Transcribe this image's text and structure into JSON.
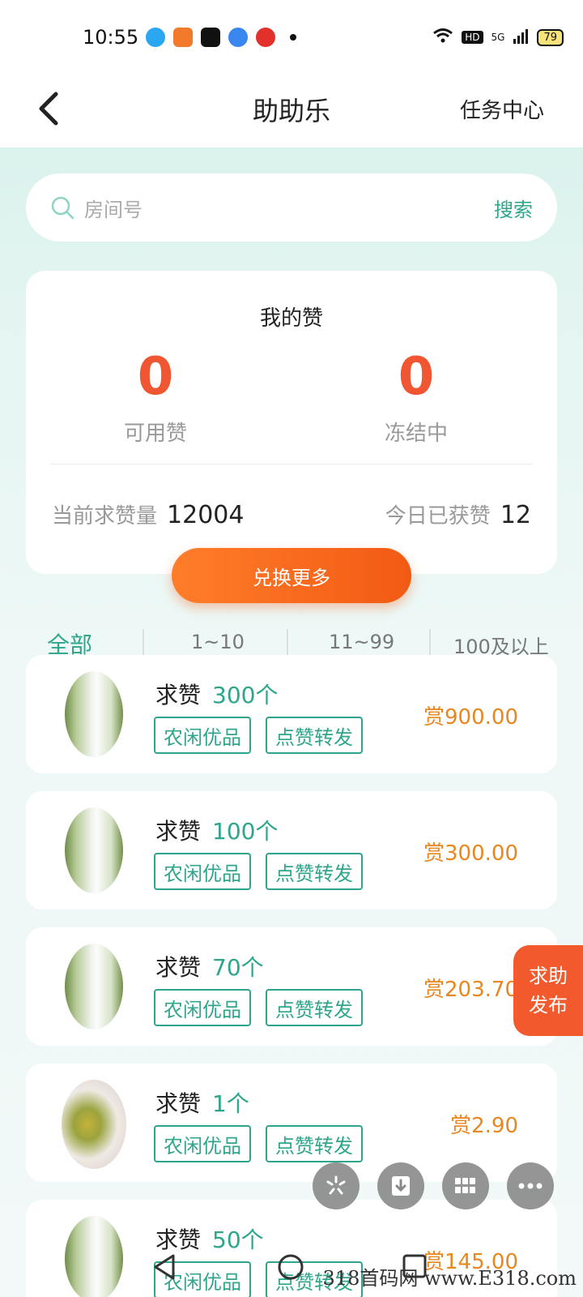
{
  "status_bar": {
    "time": "10:55",
    "battery": "79",
    "network": "5G",
    "hd": "HD"
  },
  "nav": {
    "title": "助助乐",
    "right_link": "任务中心"
  },
  "search": {
    "placeholder": "房间号",
    "button": "搜索"
  },
  "my_likes": {
    "title": "我的赞",
    "available": {
      "value": "0",
      "label": "可用赞"
    },
    "frozen": {
      "value": "0",
      "label": "冻结中"
    },
    "current_requests_label": "当前求赞量",
    "current_requests_value": "12004",
    "today_earned_label": "今日已获赞",
    "today_earned_value": "12",
    "exchange_button": "兑换更多"
  },
  "filters": [
    "全部",
    "1~10",
    "11~99",
    "100及以上"
  ],
  "tasks": [
    {
      "title": "求赞",
      "count": "300个",
      "tags": [
        "农闲优品",
        "点赞转发"
      ],
      "reward": "赏900.00",
      "thumb": "cabbage"
    },
    {
      "title": "求赞",
      "count": "100个",
      "tags": [
        "农闲优品",
        "点赞转发"
      ],
      "reward": "赏300.00",
      "thumb": "cabbage"
    },
    {
      "title": "求赞",
      "count": "70个",
      "tags": [
        "农闲优品",
        "点赞转发"
      ],
      "reward": "赏203.70",
      "thumb": "cabbage"
    },
    {
      "title": "求赞",
      "count": "1个",
      "tags": [
        "农闲优品",
        "点赞转发"
      ],
      "reward": "赏2.90",
      "thumb": "banana"
    },
    {
      "title": "求赞",
      "count": "50个",
      "tags": [
        "农闲优品",
        "点赞转发"
      ],
      "reward": "赏145.00",
      "thumb": "cabbage"
    }
  ],
  "help_fab": {
    "line1": "求助",
    "line2": "发布"
  },
  "watermark": "318首码网 www.E318.com",
  "icons": [
    "back-arrow-icon",
    "search-icon",
    "triangle-back-icon",
    "circle-home-icon",
    "square-recents-icon"
  ],
  "colors": {
    "accent": "#2fa58c",
    "orange": "#f25a14",
    "reward": "#e9871f",
    "number": "#ef5631"
  }
}
